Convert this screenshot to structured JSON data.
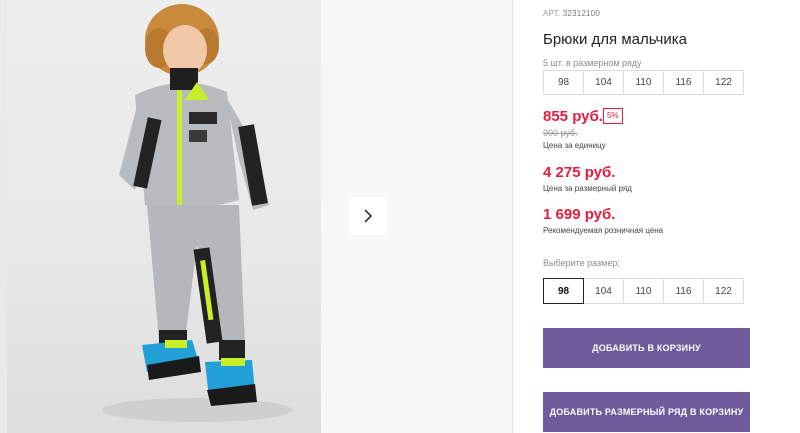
{
  "product": {
    "article_label": "АРТ.",
    "article_number": "32312100",
    "title": "Брюки для мальчика",
    "pack_note": "5 шт. в размерном ряду",
    "pack_sizes": [
      "98",
      "104",
      "110",
      "116",
      "122"
    ],
    "price": "855 руб.",
    "discount": "5%",
    "old_price": "900 руб.",
    "unit_price_caption": "Цена за единицу",
    "row_price": "4 275 руб.",
    "row_price_caption": "Цена за размерный ряд",
    "rrp": "1 699 руб.",
    "rrp_caption": "Рекомендуемая розничная цена",
    "choose_size_label": "Выберите размер:",
    "sizes": [
      "98",
      "104",
      "110",
      "116",
      "122"
    ],
    "selected_size": "98",
    "add_to_cart": "ДОБАВИТЬ В КОРЗИНУ",
    "add_row_to_cart": "ДОБАВИТЬ РАЗМЕРНЫЙ РЯД В КОРЗИНУ"
  },
  "gallery": {
    "next_icon": "chevron-right-icon",
    "photo_alt": "boy-in-grey-tracksuit-photo"
  },
  "colors": {
    "price_red": "#e31e3c",
    "button_purple": "#6f5a9c",
    "accent_green": "#c8f02a"
  }
}
